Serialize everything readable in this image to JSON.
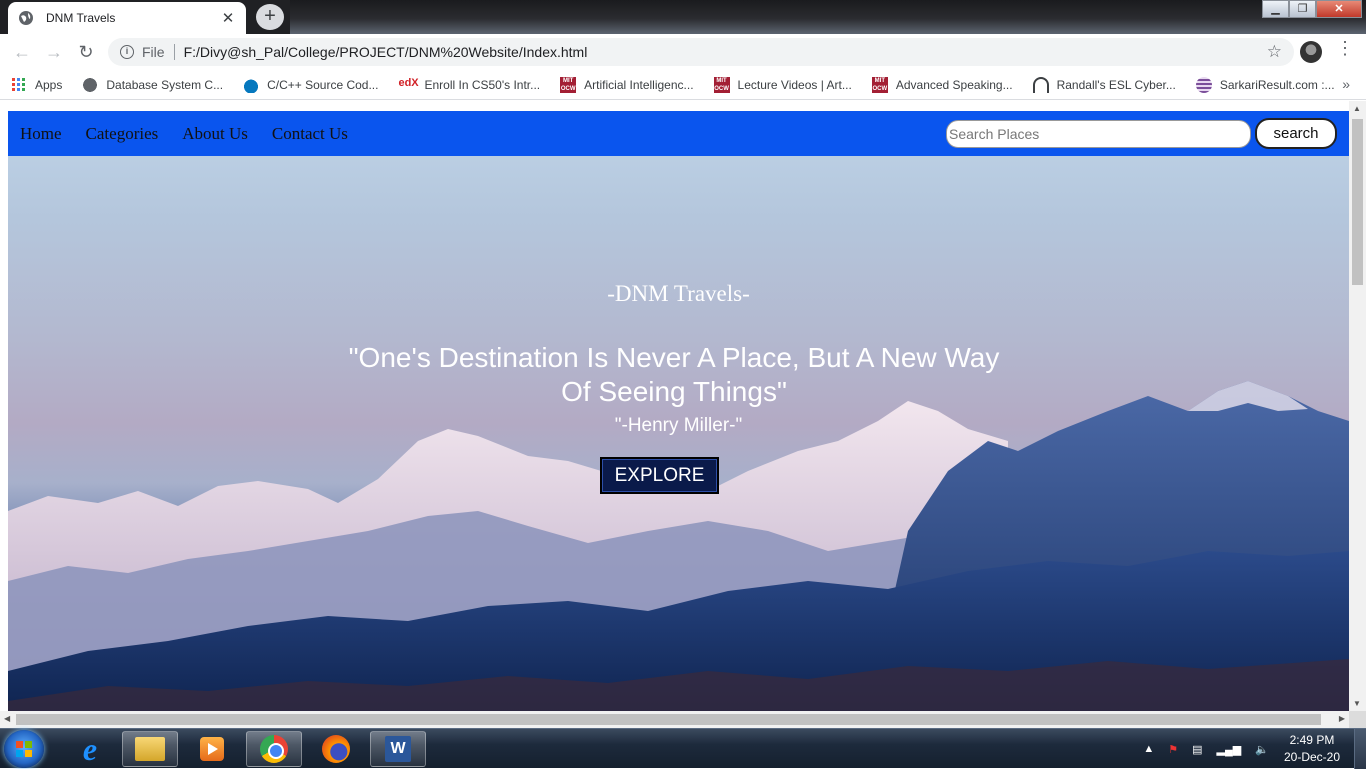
{
  "browser": {
    "tab_title": "DNM Travels",
    "tab_close": "✕",
    "new_tab": "+",
    "address_scheme_label": "File",
    "address_url": "F:/Divy@sh_Pal/College/PROJECT/DNM%20Website/Index.html",
    "bookmarks": [
      {
        "label": "Apps",
        "icon": "apps-grid-icon"
      },
      {
        "label": "Database System C...",
        "icon": "globe-icon"
      },
      {
        "label": "C/C++ Source Cod...",
        "icon": "drupal-drop-icon"
      },
      {
        "label": "Enroll In CS50's Intr...",
        "icon": "edx-icon"
      },
      {
        "label": "Artificial Intelligenc...",
        "icon": "mit-ocw-icon"
      },
      {
        "label": "Lecture Videos | Art...",
        "icon": "mit-ocw-icon"
      },
      {
        "label": "Advanced Speaking...",
        "icon": "mit-ocw-icon"
      },
      {
        "label": "Randall's ESL Cyber...",
        "icon": "headphones-icon"
      },
      {
        "label": "SarkariResult.com :...",
        "icon": "sarkari-icon"
      }
    ],
    "bookmarks_more": "»"
  },
  "site": {
    "nav": [
      "Home",
      "Categories",
      "About Us",
      "Contact Us"
    ],
    "search_placeholder": "Search Places",
    "search_button": "search",
    "brand": "-DNM Travels-",
    "quote": "\"One's Destination Is Never A Place, But A New Way Of Seeing Things\"",
    "author": "\"-Henry Miller-\"",
    "explore_button": "EXPLORE",
    "colors": {
      "navbar": "#0a55ee",
      "explore_bg": "#0a1a4a"
    }
  },
  "taskbar": {
    "time": "2:49 PM",
    "date": "20-Dec-20",
    "apps": [
      "internet-explorer-icon",
      "file-explorer-icon",
      "media-player-icon",
      "chrome-icon",
      "firefox-icon",
      "word-icon"
    ]
  }
}
